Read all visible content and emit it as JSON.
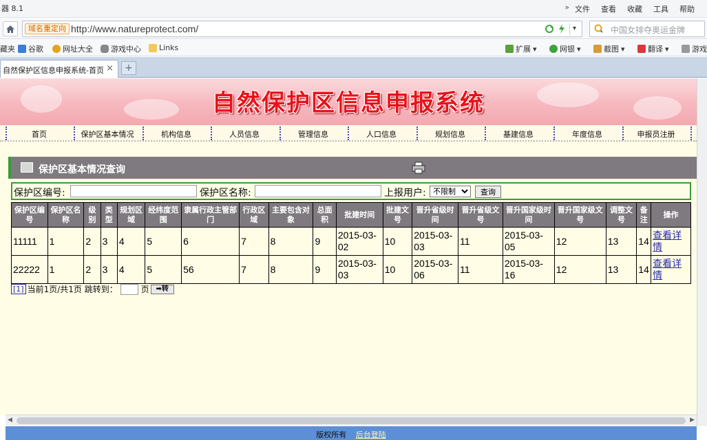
{
  "browser": {
    "app_title": "器 8.1",
    "menus": [
      "文件",
      "查看",
      "收藏",
      "工具",
      "帮助"
    ],
    "overflow": "»",
    "redirect_tag": "域名重定向",
    "url": "http://www.natureprotect.com/",
    "search_placeholder": "中国女排夺奥运金牌",
    "bookmarks": [
      "藏夹",
      "谷歌",
      "网址大全",
      "游戏中心",
      "Links",
      "扩展",
      "网银",
      "截图",
      "翻译",
      "游戏"
    ],
    "tab_title": "自然保护区信息申报系统-首页",
    "tab_close": "×",
    "new_tab": "+"
  },
  "site": {
    "title": "自然保护区信息申报系统",
    "nav": [
      "首页",
      "保护区基本情况",
      "机构信息",
      "人员信息",
      "管理信息",
      "人口信息",
      "规划信息",
      "基建信息",
      "年度信息",
      "申报员注册"
    ]
  },
  "panel": {
    "title": "保护区基本情况查询"
  },
  "search": {
    "id_label": "保护区编号:",
    "id_value": "",
    "name_label": "保护区名称:",
    "name_value": "",
    "user_label": "上报用户:",
    "user_selected": "不限制",
    "query_button": "查询"
  },
  "table": {
    "headers": [
      "保护区编号",
      "保护区名称",
      "级别",
      "类型",
      "规划区域",
      "经纬度范围",
      "隶属行政主管部门",
      "行政区域",
      "主要包含对象",
      "总面积",
      "批建时间",
      "批建文号",
      "晋升省级时间",
      "晋升省级文号",
      "晋升国家级时间",
      "晋升国家级文号",
      "调整文号",
      "备注",
      "操作"
    ],
    "rows": [
      [
        "11111",
        "1",
        "2",
        "3",
        "4",
        "5",
        "6",
        "7",
        "8",
        "9",
        "2015-03-02",
        "10",
        "2015-03-03",
        "11",
        "2015-03-05",
        "12",
        "13",
        "14",
        "查看详情"
      ],
      [
        "22222",
        "1",
        "2",
        "3",
        "4",
        "5",
        "56",
        "7",
        "8",
        "9",
        "2015-03-03",
        "10",
        "2015-03-06",
        "11",
        "2015-03-16",
        "12",
        "13",
        "14",
        "查看详情"
      ]
    ]
  },
  "pager": {
    "page_link": "[1]",
    "info": "当前1页/共1页 跳转到：",
    "unit": "页",
    "go_button": "➡转"
  },
  "footer": {
    "text": "版权所有",
    "admin_link": "后台登陆"
  },
  "colors": {
    "header_bg": "#7f7a7f",
    "accent_green": "#3b9a3b",
    "page_bg": "#fffde6",
    "title_red": "#e8121b",
    "footer_bg": "#5d8fd6"
  }
}
